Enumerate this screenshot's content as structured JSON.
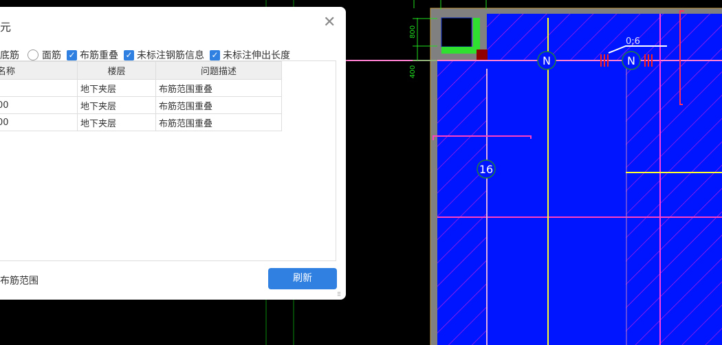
{
  "dialog": {
    "title": "图元",
    "close_icon": "close-icon",
    "options": [
      {
        "type": "radio",
        "label": "底筋",
        "checked": true
      },
      {
        "type": "radio",
        "label": "面筋",
        "checked": false
      },
      {
        "type": "checkbox",
        "label": "布筋重叠",
        "checked": true
      },
      {
        "type": "checkbox",
        "label": "未标注钢筋信息",
        "checked": true
      },
      {
        "type": "checkbox",
        "label": "未标注伸出长度",
        "checked": true
      }
    ],
    "table": {
      "headers": [
        "名称",
        "楼层",
        "问题描述"
      ],
      "rows": [
        [
          "",
          "地下夹层",
          "布筋范围重叠"
        ],
        [
          "00",
          "地下夹层",
          "布筋范围重叠"
        ],
        [
          "00",
          "地下夹层",
          "布筋范围重叠"
        ]
      ]
    },
    "bottom_label": "布筋范围",
    "refresh_label": "刷新"
  },
  "cad": {
    "dim_800": "800",
    "dim_400": "400",
    "label_06": "0;6",
    "marker_n1": "N",
    "marker_n2": "N",
    "marker_16": "16",
    "colors": {
      "background": "#000000",
      "slab": "#0015ff",
      "hatch": "#e020e0",
      "wall": "#808080",
      "yellow": "#ffff30",
      "magenta": "#ff40c0",
      "dim": "#20e020"
    }
  }
}
